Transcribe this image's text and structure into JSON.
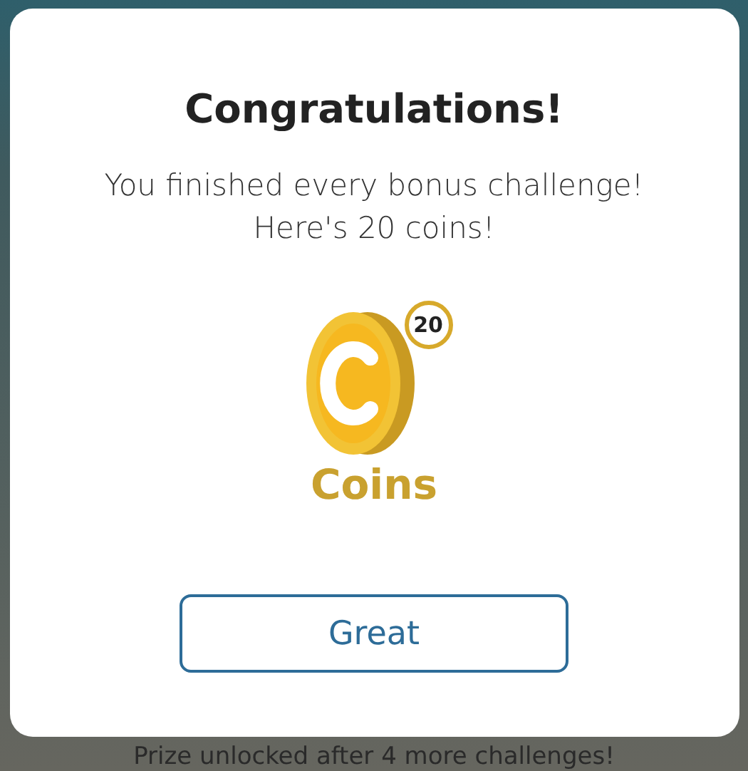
{
  "dialog": {
    "title": "Congratulations!",
    "message": [
      "You finished every bonus challenge!",
      "Here's 20 coins!"
    ],
    "reward": {
      "count": "20",
      "label": "Coins"
    },
    "buttons": [
      "Great"
    ]
  },
  "background": {
    "footer_text": "Prize unlocked after 4 more challenges!"
  }
}
